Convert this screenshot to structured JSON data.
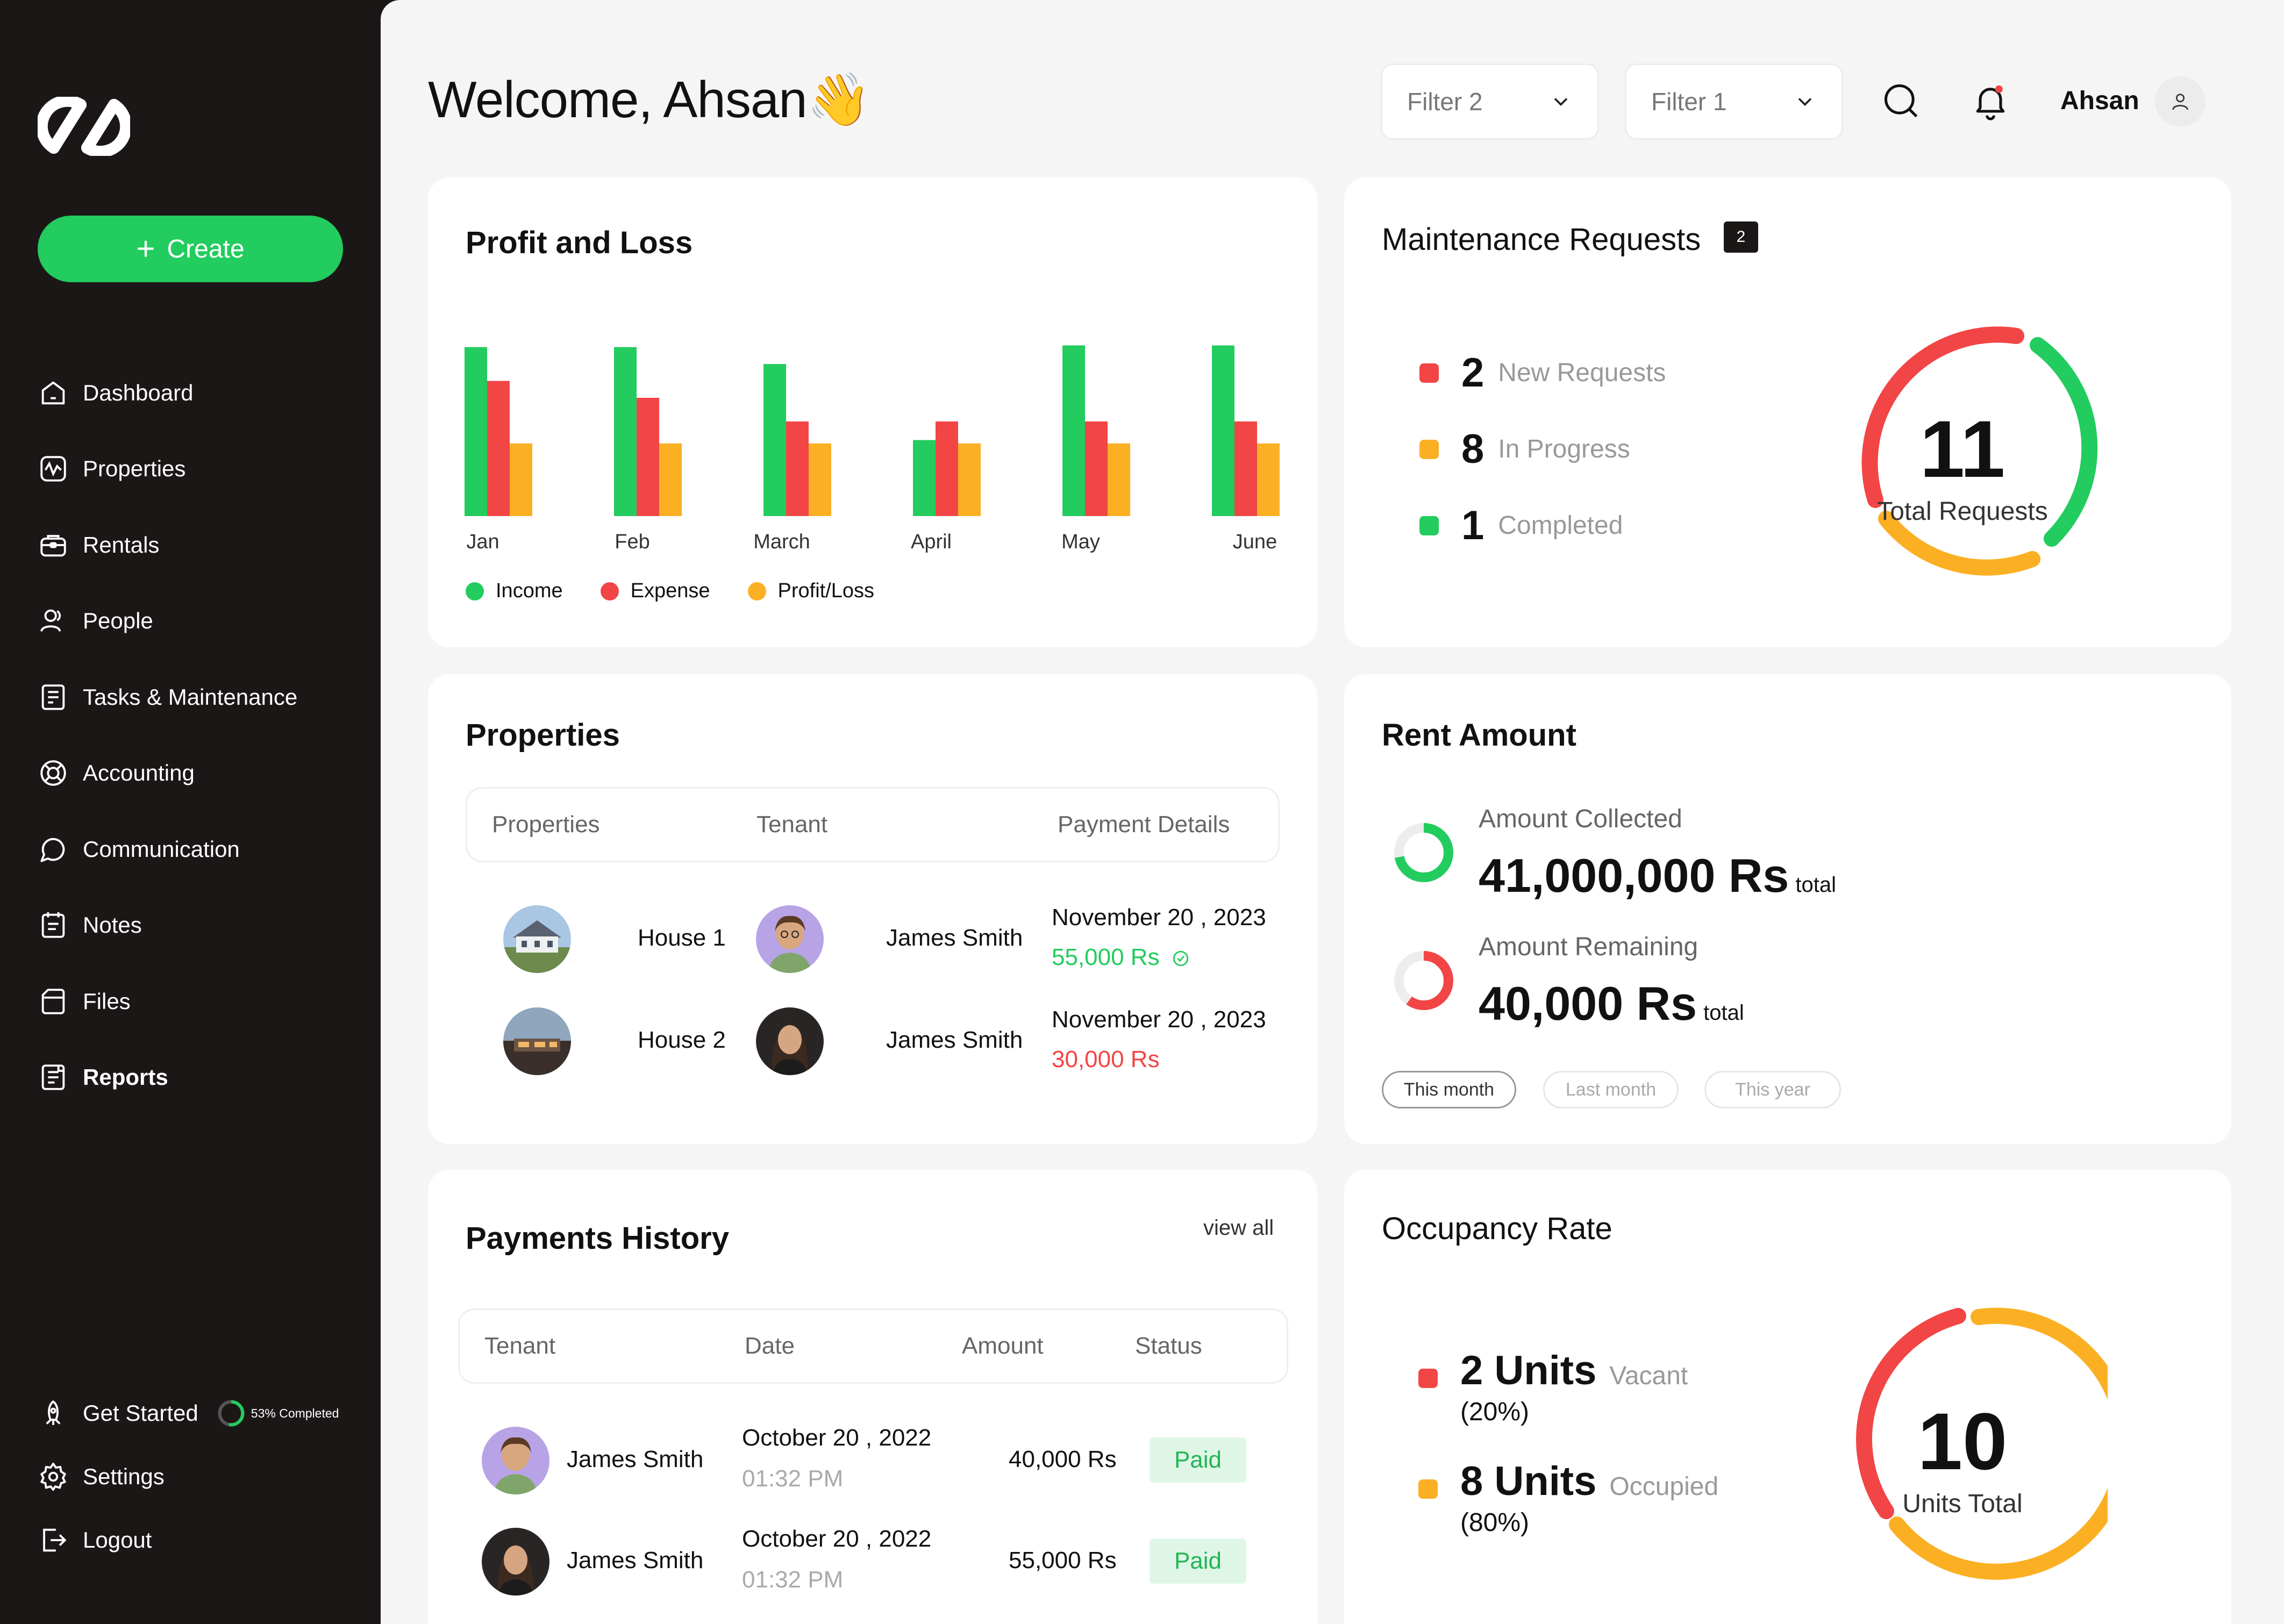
{
  "sidebar": {
    "create_label": "Create",
    "items": [
      {
        "label": "Dashboard"
      },
      {
        "label": "Properties"
      },
      {
        "label": "Rentals"
      },
      {
        "label": "People"
      },
      {
        "label": "Tasks & Maintenance"
      },
      {
        "label": "Accounting"
      },
      {
        "label": "Communication"
      },
      {
        "label": "Notes"
      },
      {
        "label": "Files"
      },
      {
        "label": "Reports"
      }
    ],
    "get_started": "Get Started",
    "progress_text": "53% Completed",
    "progress": 0.53,
    "settings": "Settings",
    "logout": "Logout"
  },
  "header": {
    "welcome": "Welcome, Ahsan👋",
    "filter2": "Filter 2",
    "filter1": "Filter 1",
    "user": "Ahsan"
  },
  "profit_loss": {
    "title": "Profit and Loss",
    "legend": [
      "Income",
      "Expense",
      "Profit/Loss"
    ]
  },
  "chart_data": {
    "type": "bar",
    "title": "Profit and Loss",
    "categories": [
      "Jan",
      "Feb",
      "March",
      "April",
      "May",
      "June"
    ],
    "series": [
      {
        "name": "Income",
        "color": "#22cc5e",
        "values": [
          100,
          100,
          90,
          45,
          101,
          101
        ]
      },
      {
        "name": "Expense",
        "color": "#f24545",
        "values": [
          80,
          70,
          56,
          56,
          56,
          56
        ]
      },
      {
        "name": "Profit/Loss",
        "color": "#fbb024",
        "values": [
          43,
          43,
          43,
          43,
          43,
          43
        ]
      }
    ],
    "ylim": [
      0,
      105
    ],
    "legend": "bottom-left"
  },
  "maintenance": {
    "title": "Maintenance Requests",
    "badge": "2",
    "rows": [
      {
        "num": "2",
        "label": "New Requests",
        "color": "#f24545"
      },
      {
        "num": "8",
        "label": "In Progress",
        "color": "#fbb024"
      },
      {
        "num": "1",
        "label": "Completed",
        "color": "#22cc5e"
      }
    ],
    "total": "11",
    "total_label": "Total Requests"
  },
  "properties": {
    "title": "Properties",
    "headers": [
      "Properties",
      "Tenant",
      "Payment Details"
    ],
    "rows": [
      {
        "property": "House 1",
        "tenant": "James Smith",
        "date": "November 20 , 2023",
        "amount": "55,000 Rs",
        "status": "paid"
      },
      {
        "property": "House 2",
        "tenant": "James Smith",
        "date": "November 20 , 2023",
        "amount": "30,000 Rs",
        "status": "due"
      }
    ]
  },
  "rent": {
    "title": "Rent Amount",
    "collected_label": "Amount Collected",
    "collected_value": "41,000,000 Rs",
    "collected_fraction": 0.72,
    "remaining_label": "Amount Remaining",
    "remaining_value": "40,000 Rs",
    "remaining_fraction": 0.6,
    "total_suffix": "total",
    "tabs": [
      "This month",
      "Last month",
      "This year"
    ]
  },
  "payments": {
    "title": "Payments History",
    "view_all": "view all",
    "headers": [
      "Tenant",
      "Date",
      "Amount",
      "Status"
    ],
    "rows": [
      {
        "tenant": "James Smith",
        "date": "October 20 , 2022",
        "time": "01:32 PM",
        "amount": "40,000 Rs",
        "status": "Paid"
      },
      {
        "tenant": "James Smith",
        "date": "October 20 , 2022",
        "time": "01:32 PM",
        "amount": "55,000 Rs",
        "status": "Paid"
      }
    ]
  },
  "occupancy": {
    "title": "Occupancy Rate",
    "rows": [
      {
        "units": "2 Units",
        "label": "Vacant",
        "pct": "(20%)",
        "color": "#f24545"
      },
      {
        "units": "8 Units",
        "label": "Occupied",
        "pct": "(80%)",
        "color": "#fbb024"
      }
    ],
    "total": "10",
    "total_label": "Units Total"
  },
  "colors": {
    "green": "#22cc5e",
    "red": "#f24545",
    "orange": "#fbb024",
    "dark": "#1c1717"
  }
}
